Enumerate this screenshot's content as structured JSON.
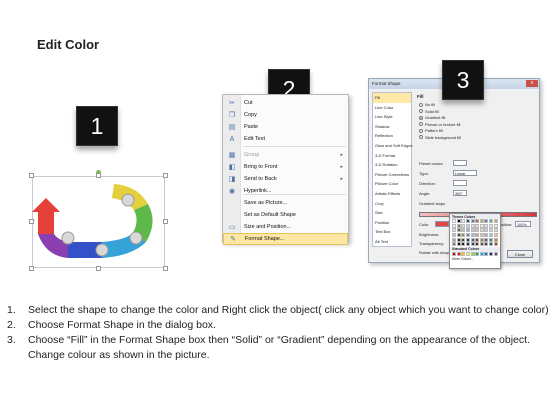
{
  "title": "Edit Color",
  "badges": [
    "1",
    "2",
    "3"
  ],
  "context_menu": {
    "items": [
      {
        "label": "Cut",
        "icon": "cut-icon",
        "glyph": "✂",
        "dim": false,
        "sub": false
      },
      {
        "label": "Copy",
        "icon": "copy-icon",
        "glyph": "❐",
        "dim": false,
        "sub": false
      },
      {
        "label": "Paste",
        "icon": "paste-icon",
        "glyph": "▤",
        "dim": false,
        "sub": false
      },
      {
        "label": "Edit Text",
        "icon": "edit-text-icon",
        "glyph": "A",
        "dim": false,
        "sub": false
      },
      {
        "label": "Group",
        "icon": "group-icon",
        "glyph": "▦",
        "dim": true,
        "sub": true
      },
      {
        "label": "Bring to Front",
        "icon": "bring-front-icon",
        "glyph": "◧",
        "dim": false,
        "sub": true
      },
      {
        "label": "Send to Back",
        "icon": "send-back-icon",
        "glyph": "◨",
        "dim": false,
        "sub": true
      },
      {
        "label": "Hyperlink...",
        "icon": "hyperlink-icon",
        "glyph": "◉",
        "dim": false,
        "sub": false
      },
      {
        "label": "Save as Picture...",
        "icon": "",
        "glyph": "",
        "dim": false,
        "sub": false
      },
      {
        "label": "Set as Default Shape",
        "icon": "",
        "glyph": "",
        "dim": false,
        "sub": false
      },
      {
        "label": "Size and Position...",
        "icon": "size-position-icon",
        "glyph": "▭",
        "dim": false,
        "sub": false
      },
      {
        "label": "Format Shape...",
        "icon": "format-shape-icon",
        "glyph": "✎",
        "dim": false,
        "sub": false,
        "highlight": true
      }
    ]
  },
  "dialog": {
    "title": "Format Shape",
    "close_x": "x",
    "nav": [
      "Fill",
      "Line Color",
      "Line Style",
      "Shadow",
      "Reflection",
      "Glow and Soft Edges",
      "3-D Format",
      "3-D Rotation",
      "Picture Corrections",
      "Picture Color",
      "Artistic Effects",
      "Crop",
      "Size",
      "Position",
      "Text Box",
      "Alt Text"
    ],
    "fill_title": "Fill",
    "radios": [
      {
        "label": "No fill",
        "on": false
      },
      {
        "label": "Solid fill",
        "on": false
      },
      {
        "label": "Gradient fill",
        "on": true
      },
      {
        "label": "Picture or texture fill",
        "on": false
      },
      {
        "label": "Pattern fill",
        "on": false
      },
      {
        "label": "Slide background fill",
        "on": false
      }
    ],
    "preset_label": "Preset colors:",
    "type_label": "Type:",
    "type_value": "Linear",
    "direction_label": "Direction:",
    "angle_label": "Angle:",
    "angle_value": "300°",
    "gradient_stops_label": "Gradient stops",
    "color_label": "Color",
    "position_label": "Position:",
    "position_value": "100%",
    "brightness_label": "Brightness:",
    "transparency_label": "Transparency:",
    "rotate_label": "Rotate with shape",
    "theme_colors_label": "Theme Colors",
    "standard_colors_label": "Standard Colors",
    "more_colors_label": "More Colors...",
    "close_label": "Close"
  },
  "palette_colors": {
    "theme": [
      [
        "#ffffff",
        "#000000",
        "#eeece1",
        "#1f497d",
        "#4f81bd",
        "#c0504d",
        "#9bbb59",
        "#8064a2",
        "#4bacc6",
        "#f79646"
      ],
      [
        "#f2f2f2",
        "#7f7f7f",
        "#ddd9c3",
        "#c6d9f0",
        "#dbe5f1",
        "#f2dcdb",
        "#ebf1dd",
        "#e5e0ec",
        "#dbeef3",
        "#fdeada"
      ],
      [
        "#d8d8d8",
        "#595959",
        "#c4bd97",
        "#8db3e2",
        "#b8cce4",
        "#e5b9b7",
        "#d7e3bc",
        "#ccc1d9",
        "#b7dde8",
        "#fbd5b5"
      ],
      [
        "#bfbfbf",
        "#3f3f3f",
        "#938953",
        "#548dd4",
        "#95b3d7",
        "#d99694",
        "#c3d69b",
        "#b2a2c7",
        "#92cddc",
        "#fac08f"
      ],
      [
        "#a5a5a5",
        "#262626",
        "#494429",
        "#17365d",
        "#366092",
        "#953734",
        "#76923c",
        "#5f497a",
        "#31859b",
        "#e36c09"
      ],
      [
        "#7f7f7f",
        "#0c0c0c",
        "#1d1b10",
        "#0f243e",
        "#244061",
        "#632423",
        "#4f6128",
        "#3f3151",
        "#205867",
        "#974806"
      ]
    ],
    "standard": [
      "#c00000",
      "#ff0000",
      "#ffc000",
      "#ffff00",
      "#92d050",
      "#00b050",
      "#00b0f0",
      "#0070c0",
      "#002060",
      "#7030a0"
    ]
  },
  "shape_colors": [
    "#e5413a",
    "#8a3fb0",
    "#3452c8",
    "#35a2d8",
    "#5fb84a",
    "#e4d03c"
  ],
  "instructions": [
    {
      "num": "1.",
      "text": "Select the shape to change the color and Right click the object( click any object which you want to change color)"
    },
    {
      "num": "2.",
      "text": "Choose Format Shape in the dialog box."
    },
    {
      "num": "3.",
      "text": "Choose “Fill” in the Format Shape box then “Solid” or “Gradient” depending on the appearance of the object. Change colour as shown in the picture."
    }
  ]
}
